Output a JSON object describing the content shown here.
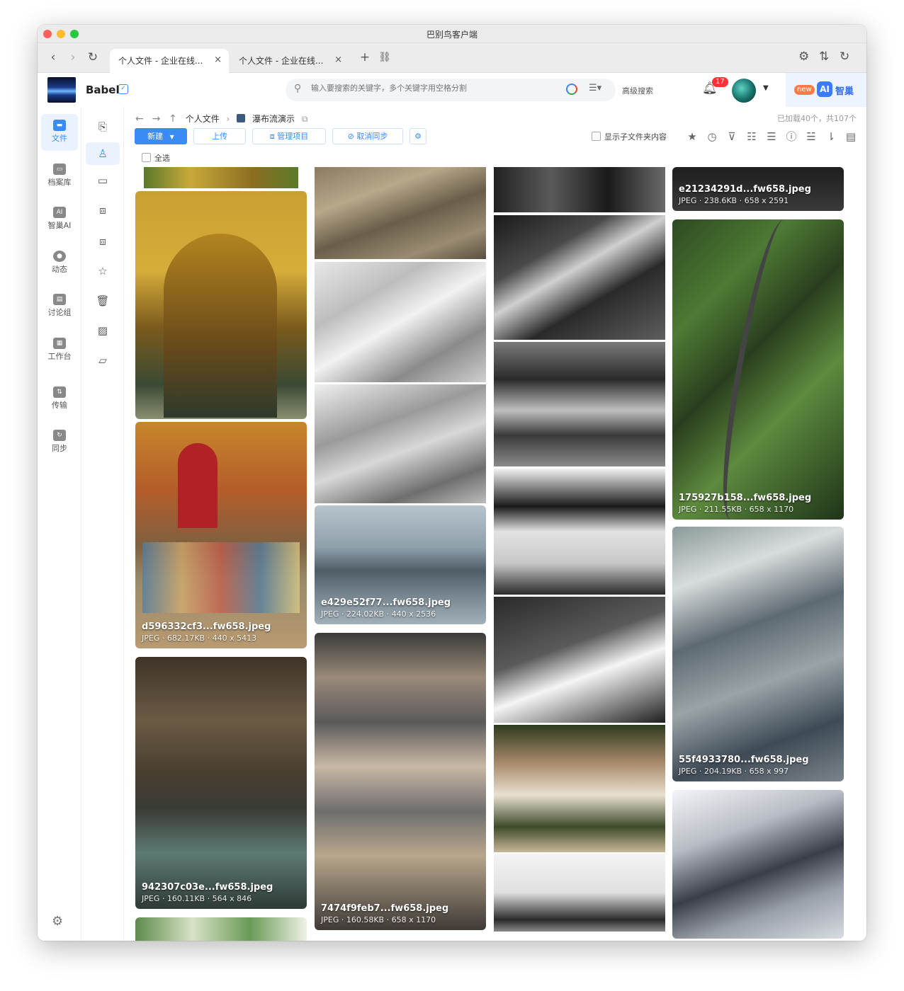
{
  "window": {
    "title": "巴别鸟客户端"
  },
  "browser": {
    "tabs": [
      {
        "label": "个人文件 - 企业在线...",
        "active": true
      },
      {
        "label": "个人文件 - 企业在线...",
        "active": false
      }
    ],
    "nav": {
      "back": "‹",
      "forward": "›",
      "reload": "↻",
      "new_tab": "+",
      "link": "⛓"
    }
  },
  "header": {
    "brand": "Babel",
    "search_placeholder": "输入要搜索的关键字，多个关键字用空格分割",
    "advanced_search": "高级搜索",
    "notifications": "17",
    "new_badge": "new",
    "ai_badge": "AI",
    "ai_label": "智巢"
  },
  "rail": [
    {
      "label": "文件",
      "icon": "folder-icon",
      "active": true
    },
    {
      "label": "档案库",
      "icon": "archive-icon",
      "active": false
    },
    {
      "label": "智巢AI",
      "icon": "ai-icon",
      "active": false
    },
    {
      "label": "动态",
      "icon": "flame-icon",
      "active": false
    },
    {
      "label": "讨论组",
      "icon": "chat-icon",
      "active": false
    },
    {
      "label": "工作台",
      "icon": "grid-icon",
      "active": false
    },
    {
      "label": "传输",
      "icon": "transfer-icon",
      "active": false
    },
    {
      "label": "同步",
      "icon": "sync-icon",
      "active": false
    }
  ],
  "breadcrumb": {
    "root": "个人文件",
    "current": "瀑布流演示"
  },
  "loaded_info": "已加载40个，共107个",
  "toolbar": {
    "new": "新建",
    "upload": "上传",
    "manage": "管理项目",
    "unsync": "取消同步",
    "show_subfolder": "显示子文件夹内容",
    "select_all": "全选"
  },
  "files": [
    {
      "name": "d596332cf3...fw658.jpeg",
      "meta": "JPEG · 682.17KB · 440 x 5413"
    },
    {
      "name": "942307c03e...fw658.jpeg",
      "meta": "JPEG · 160.11KB · 564 x 846"
    },
    {
      "name": "e429e52f77...fw658.jpeg",
      "meta": "JPEG · 224.02KB · 440 x 2536"
    },
    {
      "name": "7474f9feb7...fw658.jpeg",
      "meta": "JPEG · 160.58KB · 658 x 1170"
    },
    {
      "name": "e21234291d...fw658.jpeg",
      "meta": "JPEG · 238.6KB · 658 x 2591"
    },
    {
      "name": "175927b158...fw658.jpeg",
      "meta": "JPEG · 211.55KB · 658 x 1170"
    },
    {
      "name": "55f4933780...fw658.jpeg",
      "meta": "JPEG · 204.19KB · 658 x 997"
    }
  ]
}
